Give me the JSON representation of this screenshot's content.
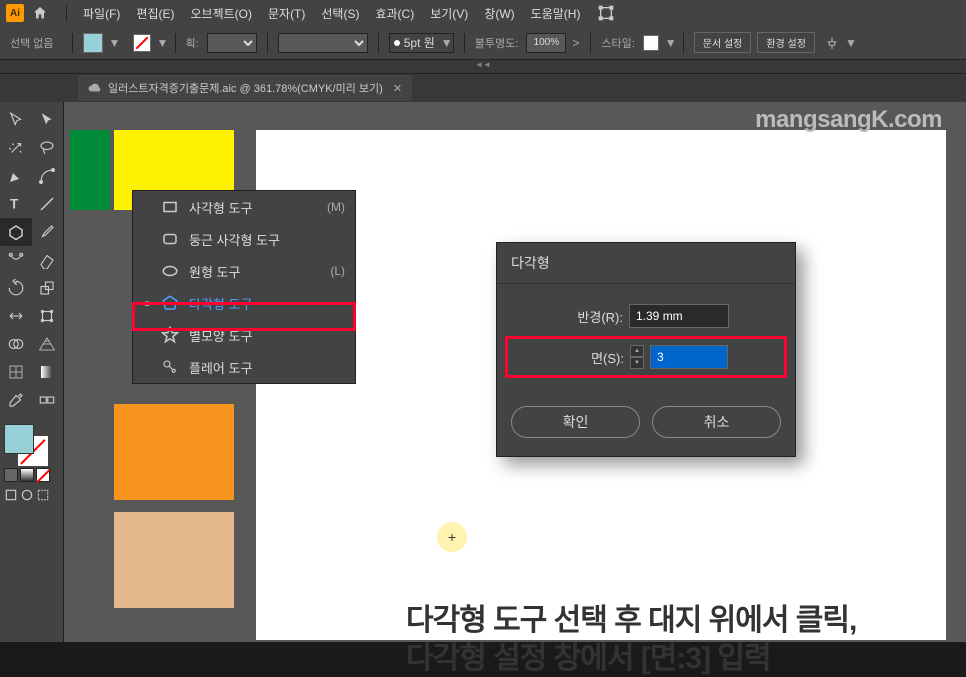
{
  "menus": [
    "파일(F)",
    "편집(E)",
    "오브젝트(O)",
    "문자(T)",
    "선택(S)",
    "효과(C)",
    "보기(V)",
    "창(W)",
    "도움말(H)"
  ],
  "control": {
    "selection": "선택 없음",
    "stroke_label": "획:",
    "round_label": "5pt 원",
    "opacity_label": "불투명도:",
    "opacity_value": "100%",
    "style_label": "스타일:",
    "doc_setup": "문서 설정",
    "env_setup": "환경 설정"
  },
  "doc_tab": "일러스트자격증기출문제.aic @ 361.78%(CMYK/미리 보기)",
  "watermark": "mangsangK.com",
  "flyout": [
    {
      "label": "사각형 도구",
      "shortcut": "(M)"
    },
    {
      "label": "둥근 사각형 도구",
      "shortcut": ""
    },
    {
      "label": "원형 도구",
      "shortcut": "(L)"
    },
    {
      "label": "다각형 도구",
      "shortcut": ""
    },
    {
      "label": "별모양 도구",
      "shortcut": ""
    },
    {
      "label": "플레어 도구",
      "shortcut": ""
    }
  ],
  "dialog": {
    "title": "다각형",
    "radius_label": "반경(R):",
    "radius_value": "1.39 mm",
    "sides_label": "면(S):",
    "sides_value": "3",
    "ok": "확인",
    "cancel": "취소"
  },
  "instruction_line1": "다각형 도구 선택 후 대지 위에서 클릭,",
  "instruction_line2": "다각형 설정 창에서 [면:3] 입력",
  "colors": {
    "fill": "#98d0d8",
    "green": "#008937",
    "yellow": "#fff200",
    "orange": "#f7941d",
    "tan": "#e5b88e"
  }
}
